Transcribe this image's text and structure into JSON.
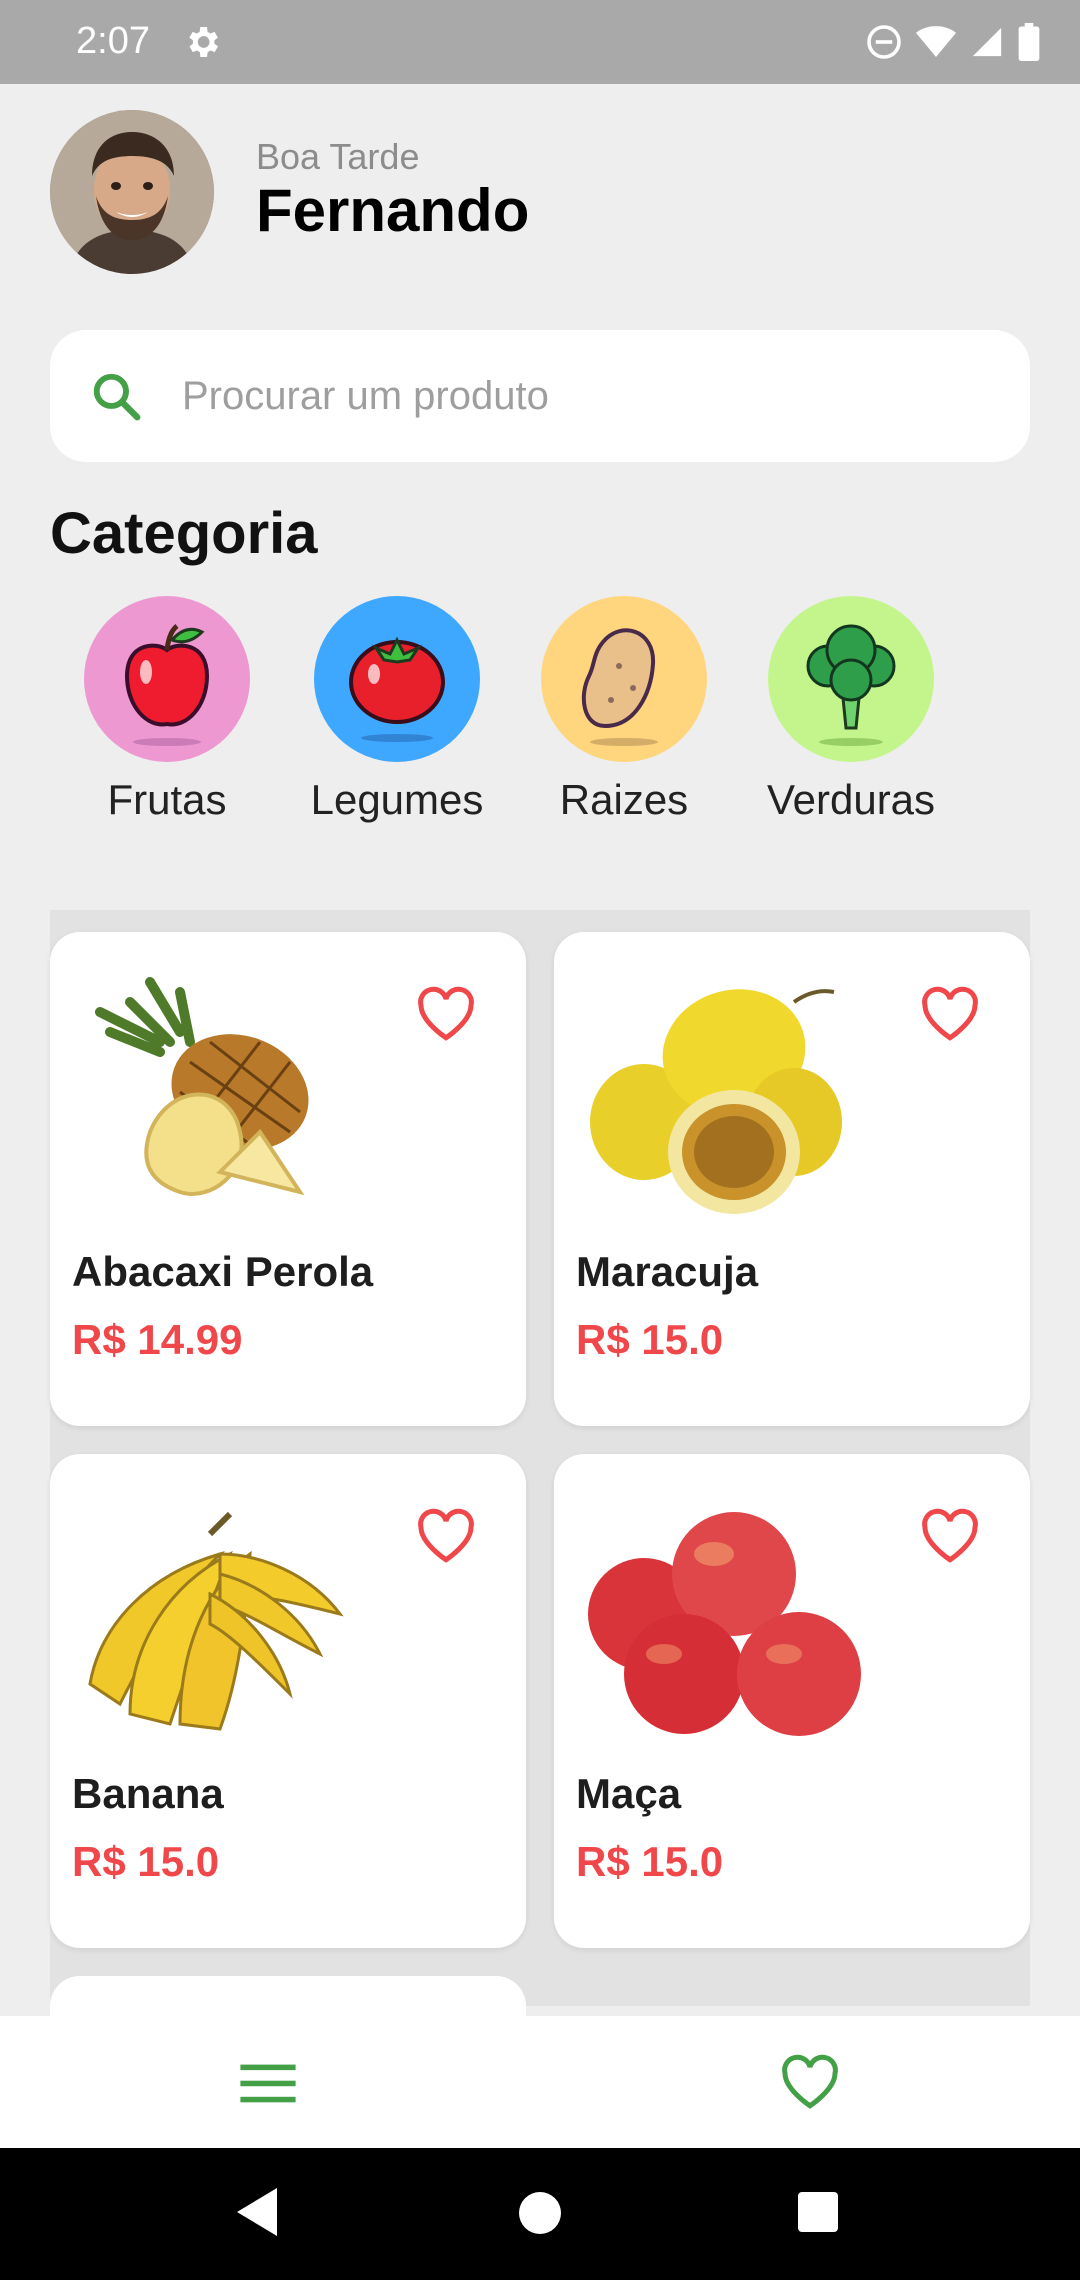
{
  "status_bar": {
    "time": "2:07"
  },
  "header": {
    "greeting": "Boa Tarde",
    "user_name": "Fernando"
  },
  "search": {
    "placeholder": "Procurar um produto",
    "value": ""
  },
  "categories": {
    "title": "Categoria",
    "items": [
      {
        "label": "Frutas",
        "icon": "apple-icon",
        "color": "#ee98d2"
      },
      {
        "label": "Legumes",
        "icon": "tomato-icon",
        "color": "#3ea7ff"
      },
      {
        "label": "Raizes",
        "icon": "potato-icon",
        "color": "#ffd57e"
      },
      {
        "label": "Verduras",
        "icon": "broccoli-icon",
        "color": "#c4f58c"
      }
    ]
  },
  "products": [
    {
      "name": "Abacaxi Perola",
      "price": "R$ 14.99",
      "image": "pineapple-image"
    },
    {
      "name": "Maracuja",
      "price": "R$ 15.0",
      "image": "passion-fruit-image"
    },
    {
      "name": "Banana",
      "price": "R$ 15.0",
      "image": "banana-image"
    },
    {
      "name": "Maça",
      "price": "R$ 15.0",
      "image": "apple-image"
    }
  ],
  "colors": {
    "accent": "#43a047",
    "price": "#f0474a",
    "heart": "#f0474a"
  },
  "bottom_nav": {
    "items": [
      "menu-icon",
      "favorites-icon"
    ]
  }
}
